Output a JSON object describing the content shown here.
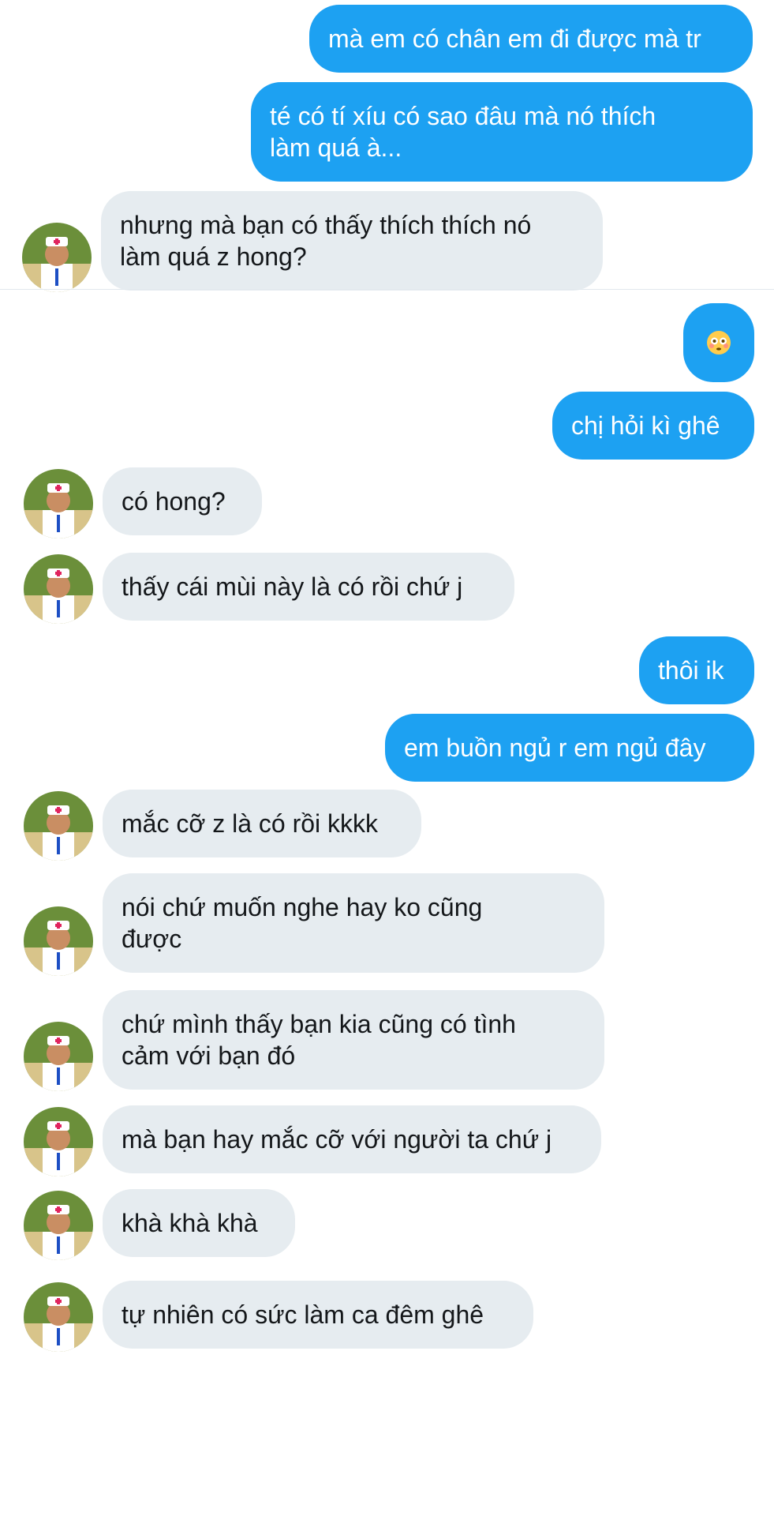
{
  "conversation": {
    "messages": [
      {
        "sender": "me",
        "text": "mà em có chân em đi được mà tr"
      },
      {
        "sender": "me",
        "text": "té có tí xíu có sao đâu mà nó thích\nlàm quá à..."
      },
      {
        "sender": "them",
        "text": "nhưng mà bạn có thấy thích thích nó\nlàm quá z hong?"
      },
      {
        "sender": "me",
        "text": "",
        "emoji": "flushed-face-emoji"
      },
      {
        "sender": "me",
        "text": "chị hỏi kì ghê"
      },
      {
        "sender": "them",
        "text": "có hong?"
      },
      {
        "sender": "them",
        "text": "thấy cái mùi này là có rồi chứ j"
      },
      {
        "sender": "me",
        "text": "thôi ik"
      },
      {
        "sender": "me",
        "text": "em buồn ngủ r em ngủ đây"
      },
      {
        "sender": "them",
        "text": "mắc cỡ z là có rồi kkkk"
      },
      {
        "sender": "them",
        "text": "nói chứ muốn nghe hay ko cũng\nđược"
      },
      {
        "sender": "them",
        "text": "chứ mình thấy bạn kia cũng có tình\ncảm với bạn đó"
      },
      {
        "sender": "them",
        "text": "mà bạn hay mắc cỡ với người ta chứ j"
      },
      {
        "sender": "them",
        "text": "khà khà khà"
      },
      {
        "sender": "them",
        "text": "tự nhiên có sức làm ca đêm ghê"
      }
    ]
  },
  "colors": {
    "sent_bubble": "#1da1f2",
    "received_bubble": "#e6ecf0",
    "sent_text": "#ffffff",
    "received_text": "#14171a"
  },
  "icons": {
    "avatar": "doctor-avatar-icon",
    "emoji": "flushed-face-emoji"
  }
}
